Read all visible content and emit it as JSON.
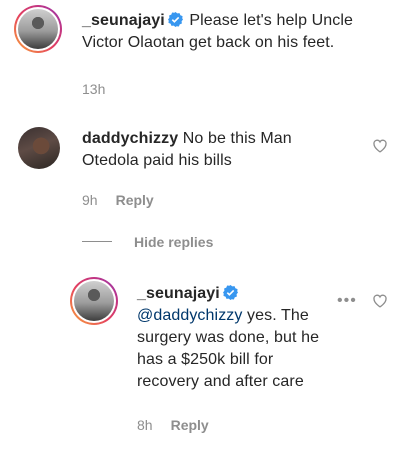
{
  "comments": [
    {
      "username": "_seunajayi",
      "verified": true,
      "text_lines": [
        "Please let's help Uncle",
        "Victor Olaotan get back on his feet."
      ],
      "time": "13h"
    },
    {
      "username": "daddychizzy",
      "verified": false,
      "text_lines": [
        "No be this Man",
        "Otedola paid his bills"
      ],
      "time": "9h",
      "reply_label": "Reply"
    }
  ],
  "hide_replies_label": "Hide replies",
  "reply": {
    "username": "_seunajayi",
    "verified": true,
    "mention": "@daddychizzy",
    "text_lines": [
      "yes. The",
      "surgery was done, but he",
      "has a $250k bill for",
      "recovery and after care"
    ],
    "time": "8h",
    "reply_label": "Reply",
    "more_label": "•••"
  },
  "colors": {
    "text": "#262626",
    "meta": "#8e8e8e",
    "mention": "#00376b",
    "verified": "#3897f0"
  },
  "icons": [
    "verified-badge-icon",
    "heart-icon",
    "more-options-icon"
  ]
}
